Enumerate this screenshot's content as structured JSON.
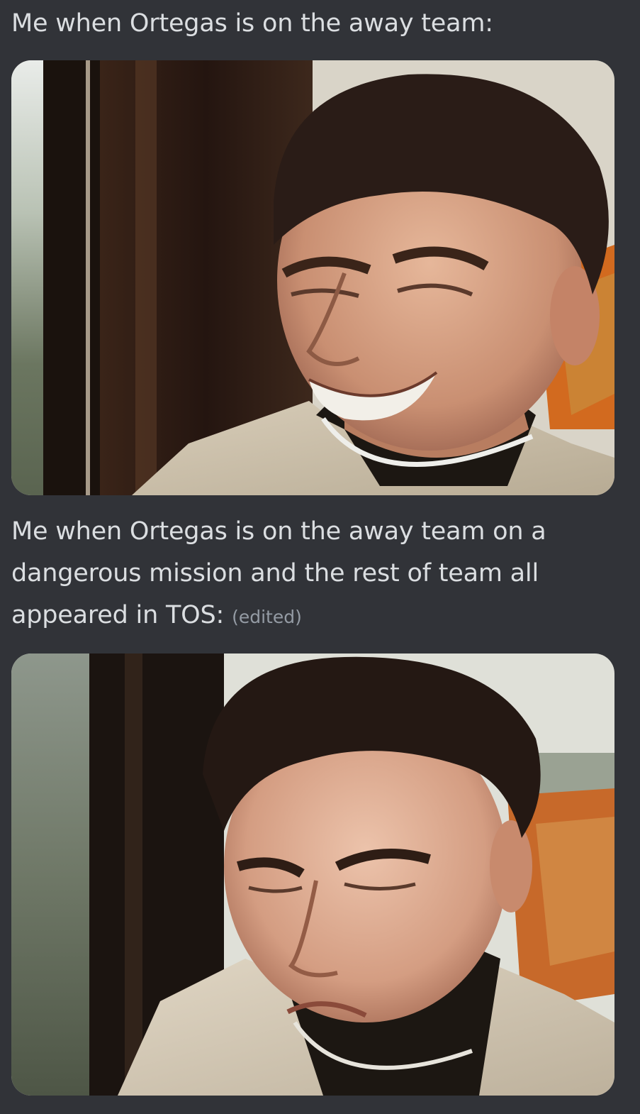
{
  "messages": [
    {
      "text": "Me when Ortegas is on the away team:",
      "edited_label": "",
      "image_alt": "Man smiling and looking sideways out of a window"
    },
    {
      "text": "Me when Ortegas is on the away team on a dangerous mission and the rest of team all appeared in TOS:",
      "edited_label": "(edited)",
      "image_alt": "Same man looking down with a pained, worried expression"
    }
  ],
  "colors": {
    "background": "#313338",
    "text": "#dbdee1",
    "muted": "#949ba4"
  }
}
